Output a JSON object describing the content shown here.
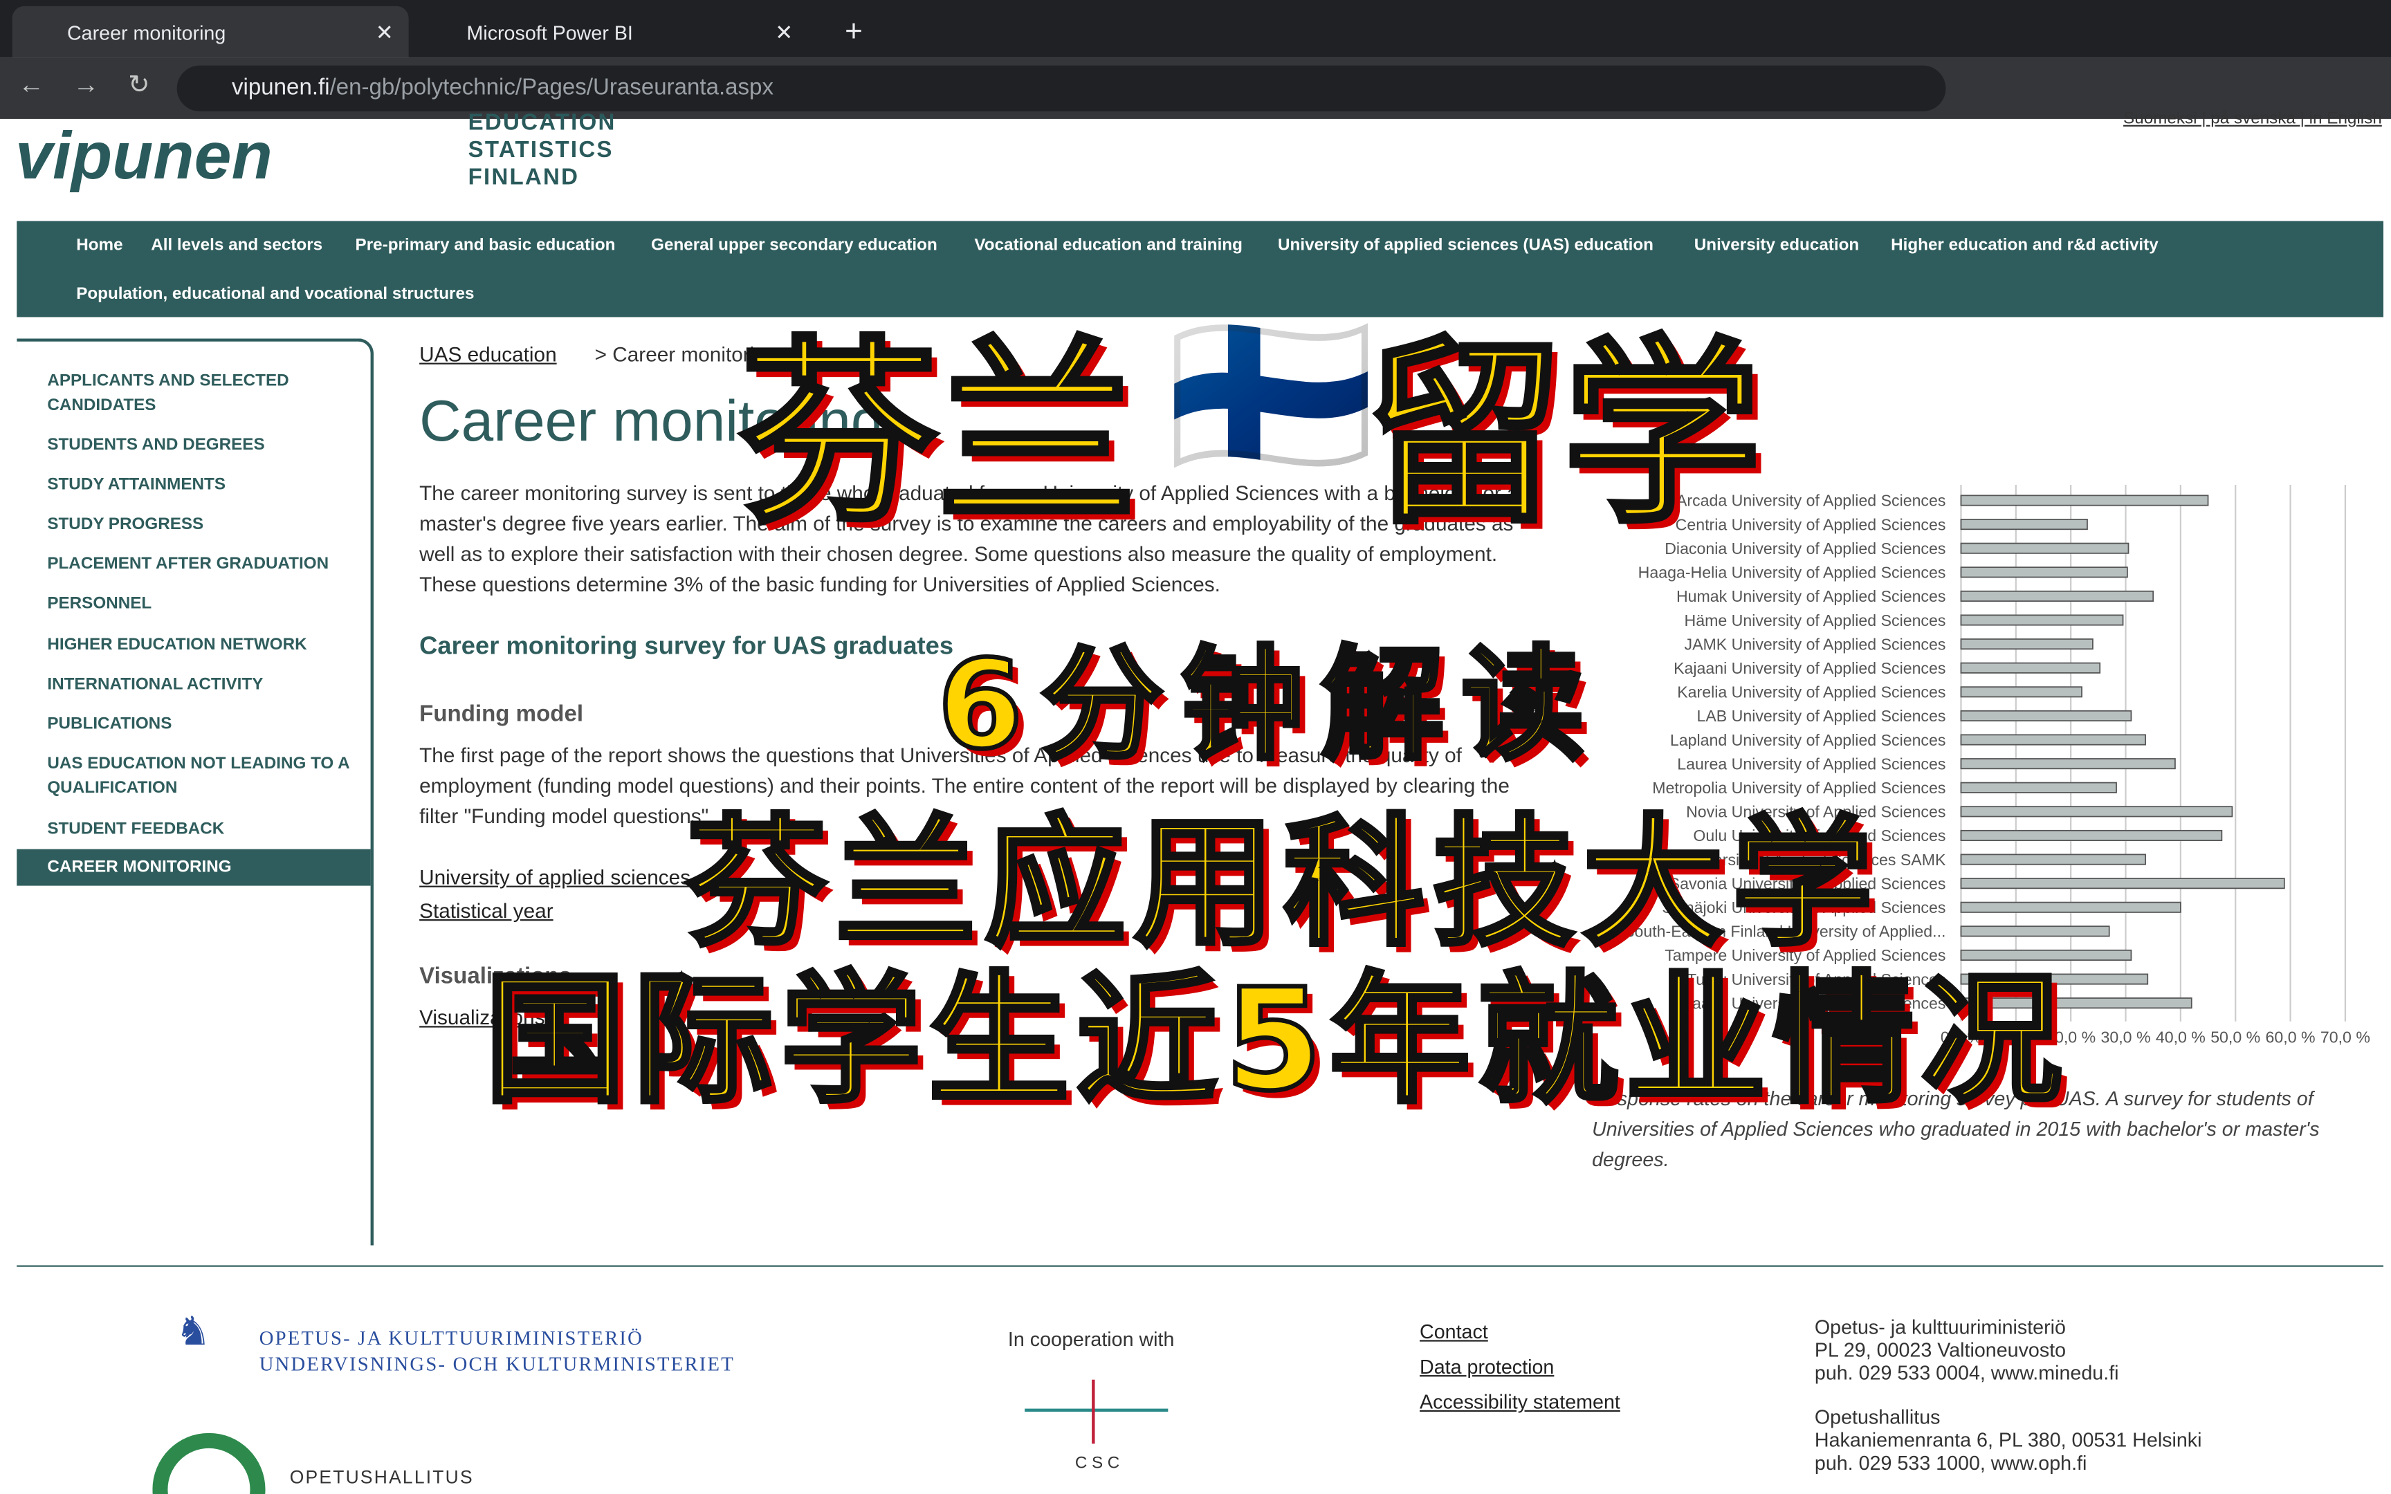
{
  "browser": {
    "tabs": [
      {
        "label": "Career monitoring"
      },
      {
        "label": "Microsoft Power BI"
      }
    ],
    "url_host": "vipunen.fi",
    "url_path": "/en-gb/polytechnic/Pages/Uraseuranta.aspx"
  },
  "header": {
    "logo": "vipunen",
    "subtitle": "EDUCATION STATISTICS FINLAND",
    "lang": "Suomeksi | på svenska | in English"
  },
  "nav": [
    "Home",
    "All levels and sectors",
    "Pre-primary and basic education",
    "General upper secondary education",
    "Vocational education and training",
    "University of applied sciences (UAS) education",
    "University education",
    "Higher education and r&d activity",
    "Population, educational and vocational structures"
  ],
  "sidebar": [
    "APPLICANTS AND SELECTED CANDIDATES",
    "STUDENTS AND DEGREES",
    "STUDY ATTAINMENTS",
    "STUDY PROGRESS",
    "PLACEMENT AFTER GRADUATION",
    "PERSONNEL",
    "HIGHER EDUCATION NETWORK",
    "INTERNATIONAL ACTIVITY",
    "PUBLICATIONS",
    "UAS EDUCATION NOT LEADING TO A QUALIFICATION",
    "STUDENT FEEDBACK",
    "CAREER MONITORING"
  ],
  "main": {
    "breadcrumb_link": "UAS education",
    "breadcrumb_current": "> Career monitoring",
    "title": "Career monitoring",
    "intro": "The career monitoring survey is sent to those who graduated from a University of Applied Sciences with a bachelor's or a master's degree five years earlier. The aim of the survey is to examine the careers and employability of the graduates as well as to explore their satisfaction with their chosen degree. Some questions also measure the quality of employment. These questions determine 3% of the basic funding for Universities of Applied Sciences.",
    "h2": "Career monitoring survey for UAS graduates",
    "h3": "Funding model",
    "funding": "The first page of the report shows the questions that Universities of Applied Sciences use to measure the quality of employment (funding model questions) and their points. The entire content of the report will be displayed by clearing the filter \"Funding model questions\".",
    "links": [
      "University of applied sciences",
      "Statistical year"
    ],
    "h3b": "Visualizations",
    "link_vis": "Visualizations",
    "caption": "Response rates on the career monitoring survey per UAS. A survey for students of Universities of Applied Sciences who graduated in 2015 with bachelor's or master's degrees."
  },
  "chart_data": {
    "type": "bar",
    "orientation": "horizontal",
    "categories": [
      "Arcada University of Applied Sciences",
      "Centria University of Applied Sciences",
      "Diaconia University of Applied Sciences",
      "Haaga-Helia University of Applied Sciences",
      "Humak University of Applied Sciences",
      "Häme University of Applied Sciences",
      "JAMK University of Applied Sciences",
      "Kajaani University of Applied Sciences",
      "Karelia University of Applied Sciences",
      "LAB University of Applied Sciences",
      "Lapland University of Applied Sciences",
      "Laurea University of Applied Sciences",
      "Metropolia University of Applied Sciences",
      "Novia University of Applied Sciences",
      "Oulu University of Applied Sciences",
      "Satakunta University of Applied Sciences SAMK",
      "Savonia University of Applied Sciences",
      "Seinäjoki University of Applied Sciences",
      "South-Eastern Finland University of Applied...",
      "Tampere University of Applied Sciences",
      "Turku University of Applied Sciences",
      "Vaasa University of Applied Sciences"
    ],
    "values": [
      45,
      23,
      30.5,
      30.3,
      35,
      29.5,
      24,
      25.3,
      22,
      31,
      33.6,
      39,
      28.3,
      49.4,
      47.5,
      33.6,
      58.9,
      40,
      27,
      31,
      34,
      42
    ],
    "xlim": [
      0,
      70
    ],
    "ticks": [
      "0,0 %",
      "10,0 %",
      "20,0 %",
      "30,0 %",
      "40,0 %",
      "50,0 %",
      "60,0 %",
      "70,0 %"
    ],
    "grid": true,
    "bar_color": "#b8bfbf"
  },
  "footer": {
    "ministry_fi": "OPETUS- JA KULTTUURIMINISTERIÖ",
    "ministry_sv": "UNDERVISNINGS- OCH KULTURMINISTERIET",
    "oph": "OPETUSHALLITUS",
    "coop": "In cooperation with",
    "csc": "CSC",
    "links": [
      "Contact",
      "Data protection",
      "Accessibility statement"
    ],
    "addr1": [
      "Opetus- ja kulttuuriministeriö",
      "PL 29, 00023 Valtioneuvosto",
      "puh. 029 533 0004, www.minedu.fi"
    ],
    "addr2": [
      "Opetushallitus",
      "Hakaniemenranta 6, PL 380, 00531 Helsinki",
      "puh. 029 533 1000, www.oph.fi"
    ]
  },
  "overlay": {
    "line1a": "芬兰",
    "flag": "🇫🇮",
    "line1b": "留学",
    "line2": "6分钟解读",
    "line3": "芬兰应用科技大学",
    "line4": "国际学生近5年就业情况"
  },
  "colors": {
    "brand": "#2f5c5c",
    "overlay_text": "#ffd400",
    "overlay_shadow": "#d40000"
  }
}
